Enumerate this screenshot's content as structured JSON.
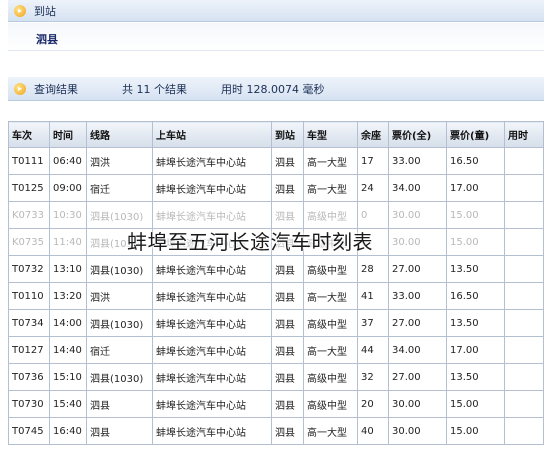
{
  "arrival_bar": {
    "label": "到站"
  },
  "arrival_station": "泗县",
  "results_bar": {
    "label": "查询结果",
    "count_text": "共 11 个结果",
    "time_text": "用时 128.0074 毫秒"
  },
  "table": {
    "headers": [
      "车次",
      "时间",
      "线路",
      "上车站",
      "到站",
      "车型",
      "余座",
      "票价(全)",
      "票价(童)",
      "用时"
    ],
    "rows": [
      [
        "T0111",
        "06:40",
        "泗洪",
        "蚌埠长途汽车中心站",
        "泗县",
        "高一大型",
        "17",
        "33.00",
        "16.50",
        ""
      ],
      [
        "T0125",
        "09:00",
        "宿迁",
        "蚌埠长途汽车中心站",
        "泗县",
        "高一大型",
        "24",
        "34.00",
        "17.00",
        ""
      ],
      [
        "K0733",
        "10:30",
        "泗县(1030)",
        "蚌埠长途汽车中心站",
        "泗县",
        "高级中型",
        "0",
        "30.00",
        "15.00",
        ""
      ],
      [
        "K0735",
        "11:40",
        "泗县(1030)",
        "蚌埠长途汽车中心站",
        "泗县",
        "高级中型",
        "0",
        "30.00",
        "15.00",
        ""
      ],
      [
        "T0732",
        "13:10",
        "泗县(1030)",
        "蚌埠长途汽车中心站",
        "泗县",
        "高级中型",
        "28",
        "27.00",
        "13.50",
        ""
      ],
      [
        "T0110",
        "13:20",
        "泗洪",
        "蚌埠长途汽车中心站",
        "泗县",
        "高一大型",
        "41",
        "33.00",
        "16.50",
        ""
      ],
      [
        "T0734",
        "14:00",
        "泗县(1030)",
        "蚌埠长途汽车中心站",
        "泗县",
        "高级中型",
        "37",
        "27.00",
        "13.50",
        ""
      ],
      [
        "T0127",
        "14:40",
        "宿迁",
        "蚌埠长途汽车中心站",
        "泗县",
        "高一大型",
        "44",
        "34.00",
        "17.00",
        ""
      ],
      [
        "T0736",
        "15:10",
        "泗县(1030)",
        "蚌埠长途汽车中心站",
        "泗县",
        "高级中型",
        "32",
        "27.00",
        "13.50",
        ""
      ],
      [
        "T0730",
        "15:40",
        "泗县",
        "蚌埠长途汽车中心站",
        "泗县",
        "高级中型",
        "20",
        "30.00",
        "15.00",
        ""
      ],
      [
        "T0745",
        "16:40",
        "泗县",
        "蚌埠长途汽车中心站",
        "泗县",
        "高一大型",
        "40",
        "30.00",
        "15.00",
        ""
      ]
    ]
  },
  "watermark_text": "蚌埠至五河长途汽车时刻表",
  "colors": {
    "header_bar": "#d6e2f2",
    "border": "#b4c0d2",
    "station_text": "#1a2a6a"
  }
}
